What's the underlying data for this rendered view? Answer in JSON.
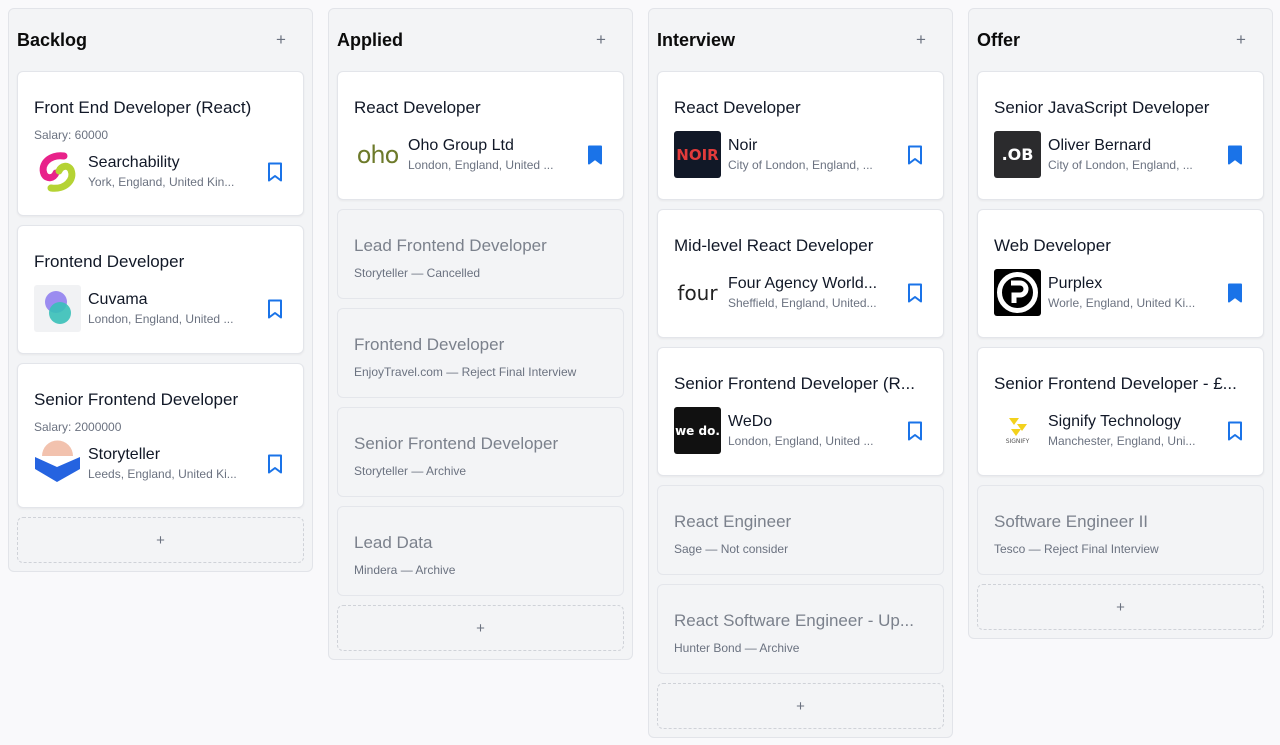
{
  "colors": {
    "accent": "#1a73e8",
    "muted_text": "#6b7280"
  },
  "columns": [
    {
      "title": "Backlog",
      "add_symbol": "+",
      "add_card_symbol": "+",
      "cards": [
        {
          "title": "Front End Developer (React)",
          "salary": "Salary: 60000",
          "company": "Searchability",
          "location": "York, England, United Kin...",
          "logo": "searchability-logo",
          "bookmarked": false
        },
        {
          "title": "Frontend Developer",
          "company": "Cuvama",
          "location": "London, England, United ...",
          "logo": "cuvama-logo",
          "bookmarked": false
        },
        {
          "title": "Senior Frontend Developer",
          "salary": "Salary: 2000000",
          "company": "Storyteller",
          "location": "Leeds, England, United Ki...",
          "logo": "storyteller-logo",
          "bookmarked": false
        }
      ]
    },
    {
      "title": "Applied",
      "add_symbol": "+",
      "add_card_symbol": "+",
      "cards": [
        {
          "title": "React Developer",
          "company": "Oho Group Ltd",
          "location": "London, England, United ...",
          "logo": "oho-logo",
          "logo_text": "oho",
          "bookmarked": true
        },
        {
          "title": "Lead Frontend Developer",
          "sub": "Storyteller — Cancelled"
        },
        {
          "title": "Frontend Developer",
          "sub": "EnjoyTravel.com — Reject Final Interview"
        },
        {
          "title": "Senior Frontend Developer",
          "sub": "Storyteller — Archive"
        },
        {
          "title": "Lead Data",
          "sub": "Mindera — Archive"
        }
      ]
    },
    {
      "title": "Interview",
      "add_symbol": "+",
      "add_card_symbol": "+",
      "cards": [
        {
          "title": "React Developer",
          "company": "Noir",
          "location": "City of London, England, ...",
          "logo": "noir-logo",
          "logo_text": "NOIR",
          "bookmarked": false
        },
        {
          "title": "Mid-level React Developer",
          "company": "Four Agency World...",
          "location": "Sheffield, England, United...",
          "logo": "four-logo",
          "logo_text": "four",
          "bookmarked": false
        },
        {
          "title": "Senior Frontend Developer (R...",
          "company": "WeDo",
          "location": "London, England, United ...",
          "logo": "wedo-logo",
          "logo_text": "we do.",
          "bookmarked": false
        },
        {
          "title": "React Engineer",
          "sub": "Sage — Not consider"
        },
        {
          "title": "React Software Engineer - Up...",
          "sub": "Hunter Bond — Archive"
        }
      ]
    },
    {
      "title": "Offer",
      "add_symbol": "+",
      "add_card_symbol": "+",
      "cards": [
        {
          "title": "Senior JavaScript Developer",
          "company": "Oliver Bernard",
          "location": "City of London, England, ...",
          "logo": "ob-logo",
          "logo_text": ".OB",
          "bookmarked": true
        },
        {
          "title": "Web Developer",
          "company": "Purplex",
          "location": "Worle, England, United Ki...",
          "logo": "purplex-logo",
          "bookmarked": true
        },
        {
          "title": "Senior Frontend Developer - £...",
          "company": "Signify Technology",
          "location": "Manchester, England, Uni...",
          "logo": "signify-logo",
          "logo_text": "SIGNIFY",
          "bookmarked": false
        },
        {
          "title": "Software Engineer II",
          "sub": "Tesco — Reject Final Interview"
        }
      ]
    }
  ]
}
